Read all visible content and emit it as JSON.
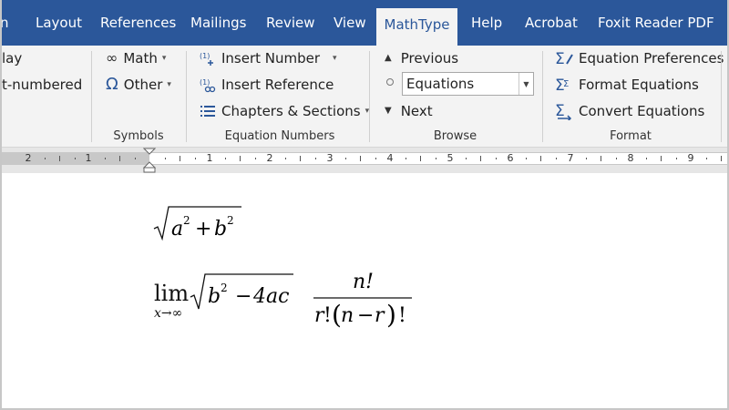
{
  "tabs": [
    {
      "label": "n",
      "active": false
    },
    {
      "label": "Layout",
      "active": false
    },
    {
      "label": "References",
      "active": false
    },
    {
      "label": "Mailings",
      "active": false
    },
    {
      "label": "Review",
      "active": false
    },
    {
      "label": "View",
      "active": false
    },
    {
      "label": "MathType",
      "active": true
    },
    {
      "label": "Help",
      "active": false
    },
    {
      "label": "Acrobat",
      "active": false
    },
    {
      "label": "Foxit Reader PDF",
      "active": false
    }
  ],
  "ribbon": {
    "partial": {
      "item1": "lay",
      "item2": "t-numbered"
    },
    "symbols": {
      "math": "Math",
      "other": "Other",
      "label": "Symbols"
    },
    "equation_numbers": {
      "insert_number": "Insert Number",
      "insert_reference": "Insert Reference",
      "chapters_sections": "Chapters & Sections",
      "label": "Equation Numbers"
    },
    "browse": {
      "previous": "Previous",
      "combo_value": "Equations",
      "next": "Next",
      "label": "Browse"
    },
    "format": {
      "equation_preferences": "Equation Preferences",
      "format_equations": "Format Equations",
      "convert_equations": "Convert Equations",
      "label": "Format"
    }
  },
  "ruler": {
    "numbers": [
      "2",
      "1",
      "1",
      "2",
      "3",
      "4",
      "5",
      "6",
      "7",
      "8",
      "9"
    ]
  },
  "document": {
    "eq1": {
      "a": "a",
      "exp1": "2",
      "plus": "+",
      "b": "b",
      "exp2": "2"
    },
    "eq2": {
      "lim": "lim",
      "lim_sub": "x→∞",
      "b": "b",
      "exp": "2",
      "minus": "−",
      "four_ac": "4ac"
    },
    "eq3": {
      "numerator": "n!",
      "r": "r",
      "fact1": "!",
      "paren_open": "(",
      "n": "n",
      "minus": "−",
      "r2": "r",
      "paren_close": ")",
      "fact2": "!"
    }
  },
  "colors": {
    "tab_bar": "#2b579a",
    "ribbon_bg": "#f3f3f3",
    "accent": "#2b579a"
  }
}
